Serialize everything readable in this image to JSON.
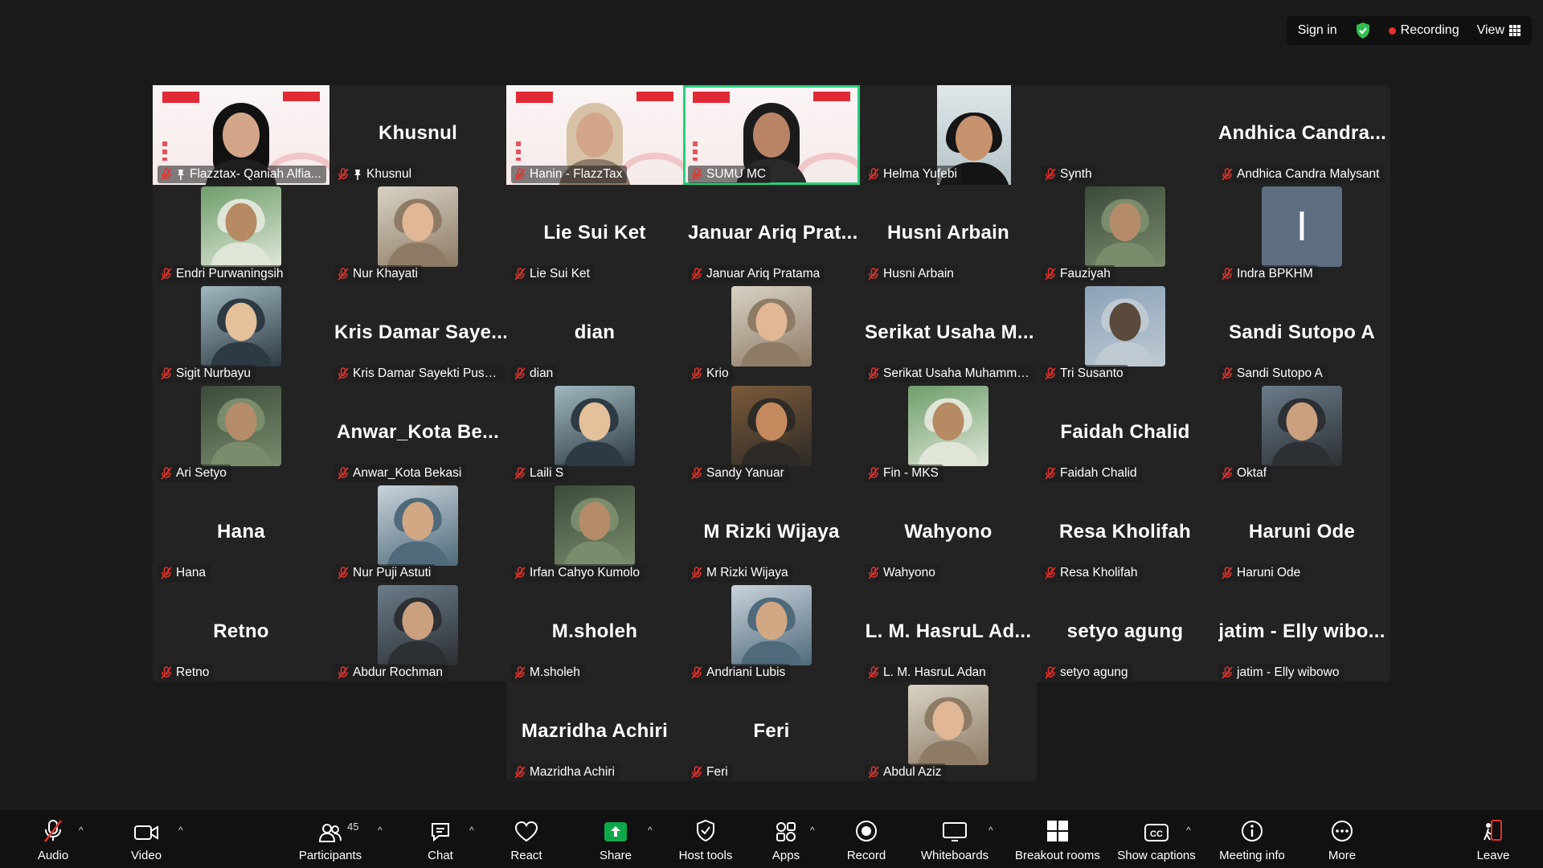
{
  "topbar": {
    "sign_in": "Sign in",
    "recording": "Recording",
    "view": "View"
  },
  "colors": {
    "active": "#25d07c",
    "mute": "#e5322d",
    "share": "#0ea84a",
    "leave": "#e5322d"
  },
  "tiles": [
    {
      "label": "Flazztax- Qaniah Alfia...",
      "big": "",
      "kind": "slide",
      "pinned": true
    },
    {
      "label": "Khusnul",
      "big": "Khusnul",
      "kind": "name",
      "pinned": true
    },
    {
      "label": "Hanin - FlazzTax",
      "big": "",
      "kind": "slide"
    },
    {
      "label": "SUMU MC",
      "big": "",
      "kind": "slide",
      "active": true
    },
    {
      "label": "Helma Yufebi",
      "big": "",
      "kind": "video"
    },
    {
      "label": "Synth",
      "big": "",
      "kind": "blank"
    },
    {
      "label": "Andhica Candra Malysant",
      "big": "Andhica  Candra...",
      "kind": "name"
    },
    {
      "label": "Endri Purwaningsih",
      "big": "",
      "kind": "photo"
    },
    {
      "label": "Nur Khayati",
      "big": "",
      "kind": "photo"
    },
    {
      "label": "Lie Sui Ket",
      "big": "Lie Sui Ket",
      "kind": "name"
    },
    {
      "label": "Januar Ariq Pratama",
      "big": "Januar  Ariq  Prat...",
      "kind": "name"
    },
    {
      "label": "Husni Arbain",
      "big": "Husni Arbain",
      "kind": "name"
    },
    {
      "label": "Fauziyah",
      "big": "",
      "kind": "photo"
    },
    {
      "label": "Indra BPKHM",
      "big": "",
      "kind": "initial",
      "initial": "I"
    },
    {
      "label": "Sigit Nurbayu",
      "big": "",
      "kind": "photo"
    },
    {
      "label": "Kris Damar Sayekti Puspa...",
      "big": "Kris  Damar  Saye...",
      "kind": "name"
    },
    {
      "label": "dian",
      "big": "dian",
      "kind": "name"
    },
    {
      "label": "Krio",
      "big": "",
      "kind": "photo"
    },
    {
      "label": "Serikat Usaha Muhamma...",
      "big": "Serikat  Usaha  M...",
      "kind": "name"
    },
    {
      "label": "Tri Susanto",
      "big": "",
      "kind": "photo"
    },
    {
      "label": "Sandi Sutopo A",
      "big": "Sandi Sutopo A",
      "kind": "name"
    },
    {
      "label": "Ari Setyo",
      "big": "",
      "kind": "photo"
    },
    {
      "label": "Anwar_Kota Bekasi",
      "big": "Anwar_Kota  Be...",
      "kind": "name"
    },
    {
      "label": "Laili S",
      "big": "",
      "kind": "photo"
    },
    {
      "label": "Sandy Yanuar",
      "big": "",
      "kind": "photo"
    },
    {
      "label": "Fin - MKS",
      "big": "",
      "kind": "photo"
    },
    {
      "label": "Faidah Chalid",
      "big": "Faidah Chalid",
      "kind": "name"
    },
    {
      "label": "Oktaf",
      "big": "",
      "kind": "photo"
    },
    {
      "label": "Hana",
      "big": "Hana",
      "kind": "name"
    },
    {
      "label": "Nur Puji Astuti",
      "big": "",
      "kind": "photo"
    },
    {
      "label": "Irfan Cahyo Kumolo",
      "big": "",
      "kind": "photo"
    },
    {
      "label": "M Rizki Wijaya",
      "big": "M Rizki Wijaya",
      "kind": "name"
    },
    {
      "label": "Wahyono",
      "big": "Wahyono",
      "kind": "name"
    },
    {
      "label": "Resa Kholifah",
      "big": "Resa Kholifah",
      "kind": "name"
    },
    {
      "label": "Haruni Ode",
      "big": "Haruni Ode",
      "kind": "name"
    },
    {
      "label": "Retno",
      "big": "Retno",
      "kind": "name"
    },
    {
      "label": "Abdur Rochman",
      "big": "",
      "kind": "photo"
    },
    {
      "label": "M.sholeh",
      "big": "M.sholeh",
      "kind": "name"
    },
    {
      "label": "Andriani Lubis",
      "big": "",
      "kind": "photo"
    },
    {
      "label": "L. M. HasruL Adan",
      "big": "L.  M.  HasruL  Ad...",
      "kind": "name"
    },
    {
      "label": "setyo agung",
      "big": "setyo agung",
      "kind": "name"
    },
    {
      "label": "jatim - Elly wibowo",
      "big": "jatim  -  Elly  wibo...",
      "kind": "name"
    },
    {
      "label": "Mazridha Achiri",
      "big": "Mazridha Achiri",
      "kind": "name"
    },
    {
      "label": "Feri",
      "big": "Feri",
      "kind": "name"
    },
    {
      "label": "Abdul Aziz",
      "big": "",
      "kind": "photo"
    }
  ],
  "toolbar": {
    "audio": "Audio",
    "video": "Video",
    "participants": "Participants",
    "participants_count": "45",
    "chat": "Chat",
    "react": "React",
    "share": "Share",
    "host_tools": "Host tools",
    "apps": "Apps",
    "record": "Record",
    "whiteboards": "Whiteboards",
    "breakout_rooms": "Breakout rooms",
    "show_captions": "Show captions",
    "meeting_info": "Meeting info",
    "more": "More",
    "leave": "Leave"
  }
}
